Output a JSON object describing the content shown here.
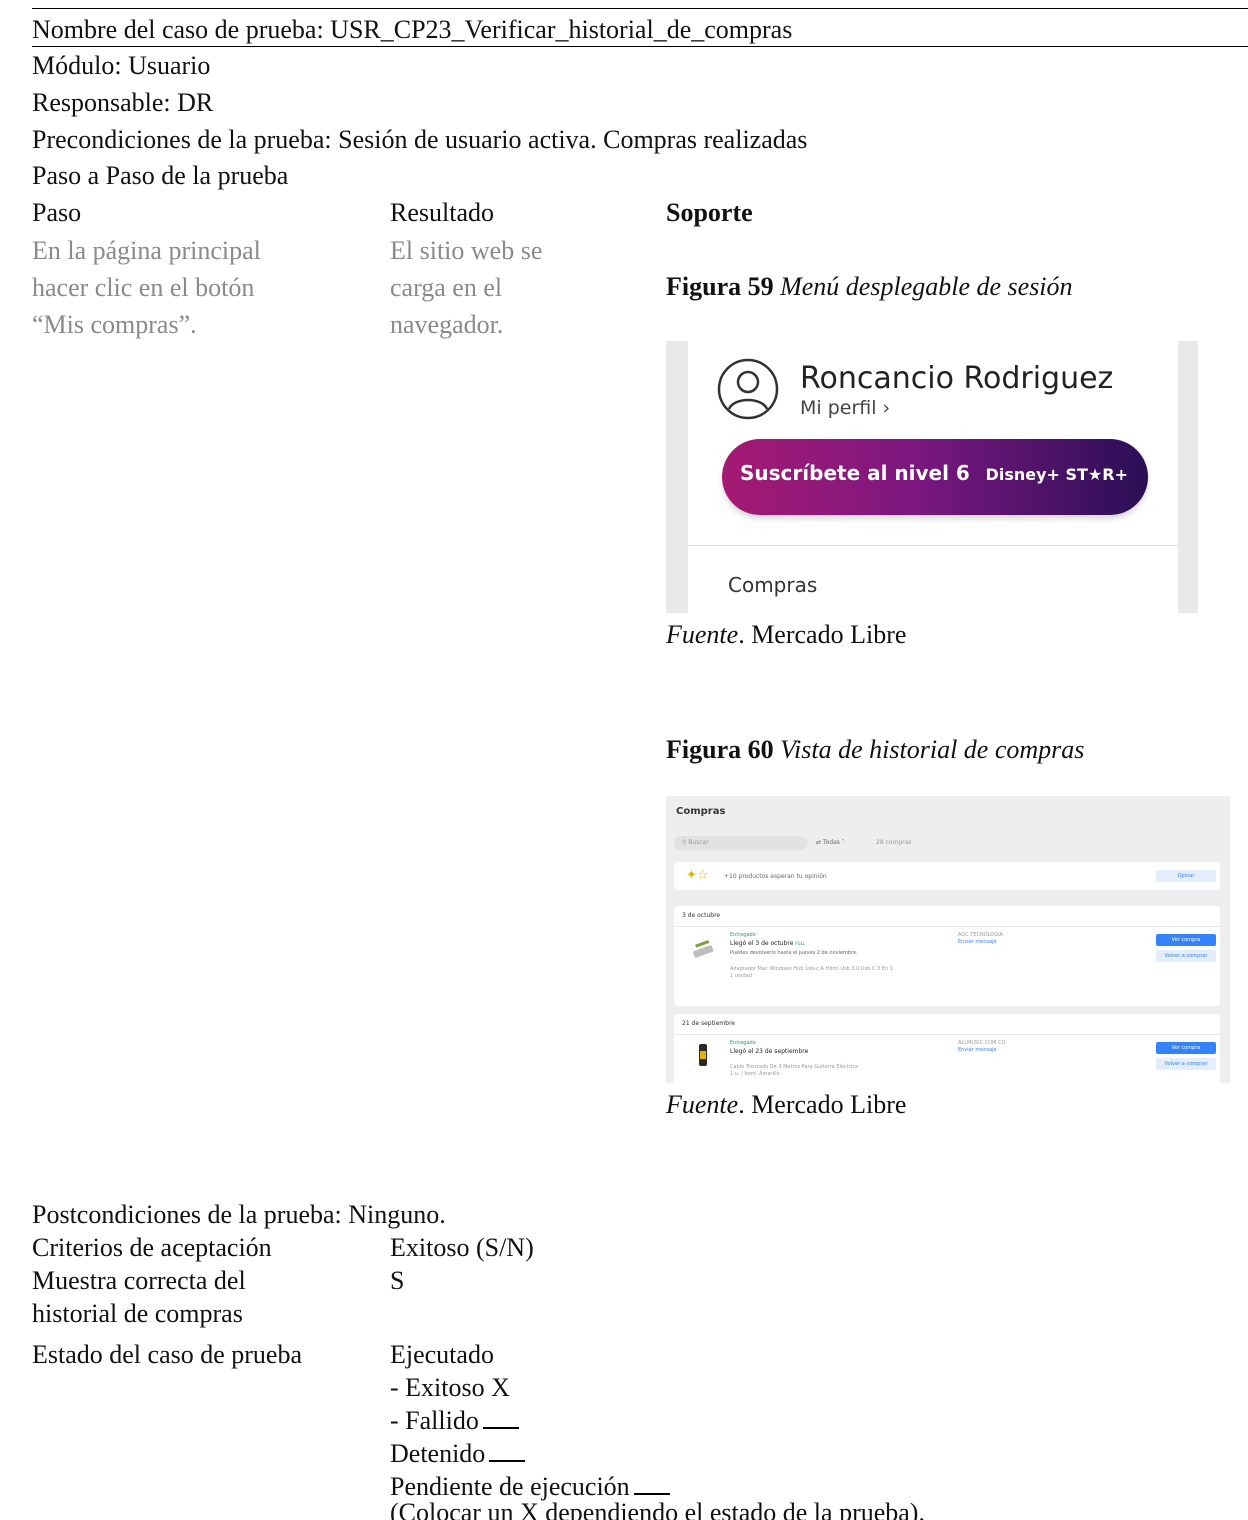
{
  "header": {
    "case_name": "Nombre del caso de prueba: USR_CP23_Verificar_historial_de_compras",
    "module": "Módulo: Usuario",
    "responsible": "Responsable: DR",
    "preconditions": "Precondiciones de la prueba: Sesión de usuario activa. Compras realizadas",
    "steps_title": "Paso a Paso de la prueba"
  },
  "steps_table": {
    "col_step": "Paso",
    "col_result": "Resultado",
    "col_support": "Soporte",
    "step_lines": [
      "En la página principal",
      "hacer clic en el botón",
      "“Mis compras”."
    ],
    "result_lines": [
      "El sitio web se",
      "carga en el",
      "navegador."
    ]
  },
  "figure59": {
    "number": "Figura 59",
    "caption": "Menú desplegable de sesión",
    "source_label": "Fuente",
    "source_text": ". Mercado Libre",
    "user_name": "Roncancio Rodriguez",
    "profile_link": "Mi perfil ›",
    "subscribe_label": "Suscríbete al nivel 6",
    "subscribe_brand": "Disney+ ST★R+",
    "menu_item": "Compras"
  },
  "figure60": {
    "number": "Figura 60",
    "caption": "Vista de historial de compras",
    "source_label": "Fuente",
    "source_text": ". Mercado Libre",
    "title": "Compras",
    "search_placeholder": "Buscar",
    "filter": "Todas",
    "count": "28 compras",
    "opinion_text": "+10 productos esperan tu opinión",
    "opinion_button": "Opinar",
    "groups": [
      {
        "date": "3 de octubre",
        "status": "Entregado",
        "arrived": "Llegó el 3 de octubre",
        "full": "FULL",
        "return_note": "Puedes devolverlo hasta el jueves 2 de noviembre.",
        "product": "Adaptador Mac Windows Hub Usb-c A Hdmi Usb 3.0 Usb C 3 En 1",
        "qty": "1 unidad",
        "seller": "AGC TECNOLOGIA",
        "message": "Enviar mensaje",
        "view_button": "Ver compra",
        "buy_again": "Volver a comprar"
      },
      {
        "date": "21 de septiembre",
        "status": "Entregado",
        "arrived": "Llegó el 23 de septiembre",
        "product": "Cable Trenzado De 3 Metros Para Guitarra Eléctrica",
        "qty": "1 u. | Item: Amarillo",
        "seller": "ALLMUSIC.COM.CO",
        "message": "Enviar mensaje",
        "view_button": "Ver compra",
        "buy_again": "Volver a comprar"
      }
    ]
  },
  "footer": {
    "postconditions": "Postcondiciones de la prueba: Ninguno.",
    "criteria_label": "Criterios de aceptación",
    "success_label": "Exitoso (S/N)",
    "criterion_lines": [
      "Muestra correcta del",
      "historial de compras"
    ],
    "criterion_value": "S",
    "state_label": "Estado del caso de prueba",
    "executed": "Ejecutado",
    "executed_success": "- Exitoso X",
    "executed_failed": "- Fallido",
    "stopped": "Detenido",
    "pending": "Pendiente de ejecución",
    "note": "(Colocar un X dependiendo el estado de la prueba)."
  }
}
